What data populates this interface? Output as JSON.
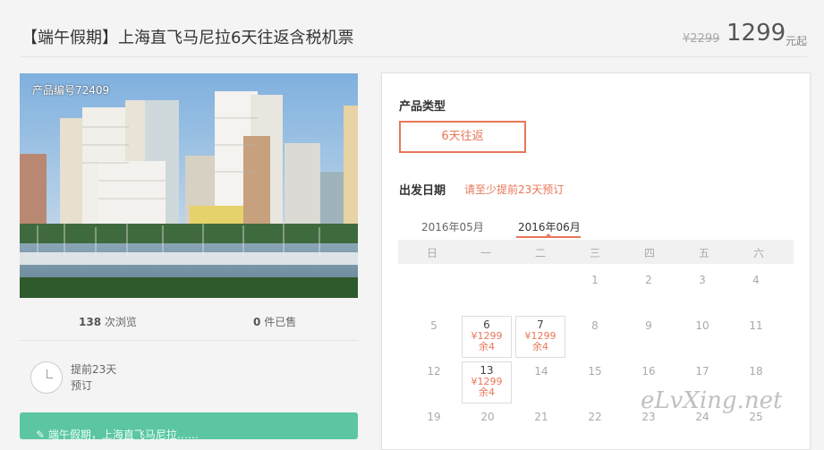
{
  "header": {
    "title": "【端午假期】上海直飞马尼拉6天往返含税机票",
    "old_price": "¥2299",
    "price": "1299",
    "price_unit": "元起"
  },
  "left": {
    "product_no": "产品编号72409",
    "views_num": "138",
    "views_label": "次浏览",
    "sold_num": "0",
    "sold_label": "件已售",
    "advance_line1": "提前23天",
    "advance_line2": "预订",
    "green_bar_text": "✎ 端午假期，上海直飞马尼拉……"
  },
  "panel": {
    "type_label": "产品类型",
    "type_option": "6天往返",
    "date_label": "出发日期",
    "date_tip": "请至少提前23天预订",
    "months": [
      "2016年05月",
      "2016年06月"
    ],
    "weekdays": [
      "日",
      "一",
      "二",
      "三",
      "四",
      "五",
      "六"
    ],
    "row1": [
      "1",
      "2",
      "3",
      "4"
    ],
    "row2": [
      "5",
      "6",
      "7",
      "8",
      "9",
      "10",
      "11"
    ],
    "row3": [
      "12",
      "13",
      "14",
      "15",
      "16",
      "17",
      "18"
    ],
    "row4": [
      "19",
      "20",
      "21",
      "22",
      "23",
      "24",
      "25"
    ],
    "avail_price": "¥1299",
    "avail_left": "余4"
  },
  "watermark": "eLvXing.net",
  "colors": {
    "accent": "#e8775a",
    "green": "#5cc6a2"
  }
}
